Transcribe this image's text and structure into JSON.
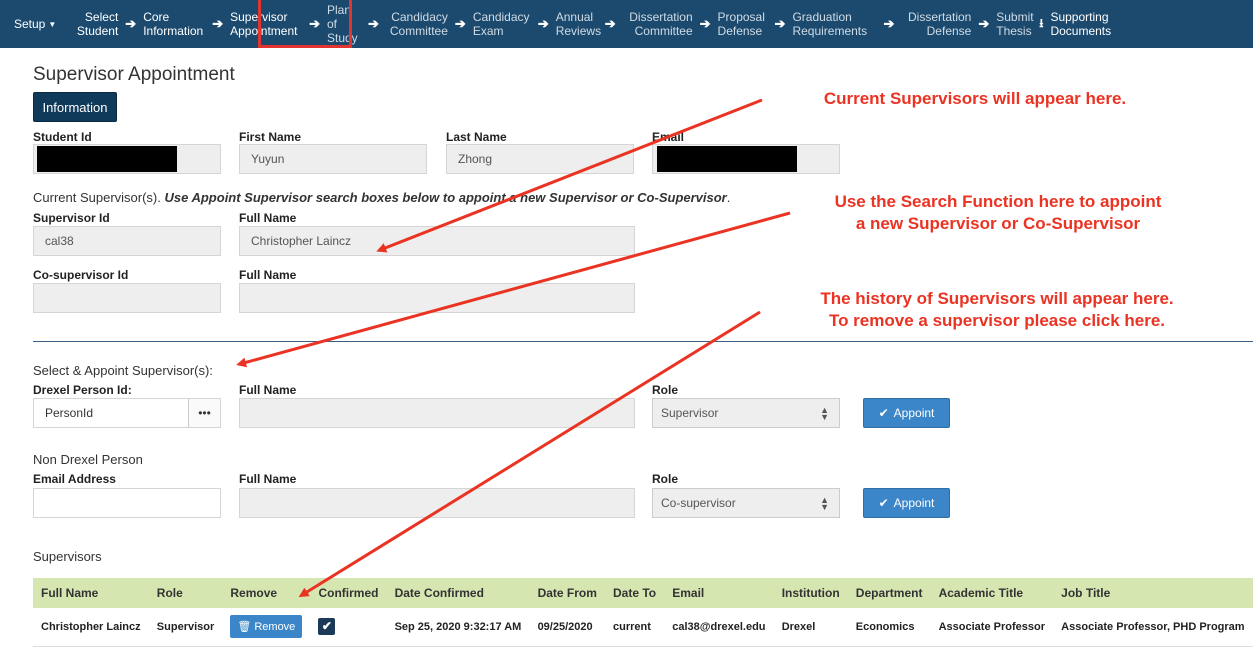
{
  "nav": {
    "setup": "Setup",
    "items": [
      {
        "l1": "Select",
        "l2": "Student"
      },
      {
        "l1": "Core",
        "l2": "Information"
      },
      {
        "l1": "Supervisor",
        "l2": "Appointment"
      },
      {
        "l1": "Plan of",
        "l2": "Study"
      },
      {
        "l1": "Candidacy",
        "l2": "Committee"
      },
      {
        "l1": "Candidacy",
        "l2": "Exam"
      },
      {
        "l1": "Annual",
        "l2": "Reviews"
      },
      {
        "l1": "Dissertation",
        "l2": "Committee"
      },
      {
        "l1": "Proposal",
        "l2": "Defense"
      },
      {
        "l1": "Graduation",
        "l2": "Requirements"
      },
      {
        "l1": "Dissertation",
        "l2": "Defense"
      },
      {
        "l1": "Submit",
        "l2": "Thesis"
      },
      {
        "l1": "Supporting",
        "l2": "Documents"
      }
    ]
  },
  "page_title": "Supervisor Appointment",
  "info_button": "Information",
  "student": {
    "id_label": "Student Id",
    "first_label": "First Name",
    "first_value": "Yuyun",
    "last_label": "Last Name",
    "last_value": "Zhong",
    "email_label": "Email"
  },
  "current": {
    "intro": "Current Supervisor(s).",
    "instruction": "Use Appoint Supervisor search boxes below to appoint a new Supervisor or Co-Supervisor",
    "supervisor_id_label": "Supervisor Id",
    "supervisor_id": "cal38",
    "full_name_label": "Full Name",
    "full_name": "Christopher Laincz",
    "cosup_id_label": "Co-supervisor Id",
    "cosup_full_name_label": "Full Name"
  },
  "appoint": {
    "title": "Select & Appoint Supervisor(s):",
    "person_id_label": "Drexel Person Id:",
    "person_id_value": "PersonId",
    "dots": "•••",
    "full_name_label": "Full Name",
    "role_label": "Role",
    "role_value": "Supervisor",
    "appoint_label": "Appoint"
  },
  "non_drexel": {
    "title": "Non Drexel Person",
    "email_label": "Email Address",
    "full_name_label": "Full Name",
    "role_label": "Role",
    "role_value": "Co-supervisor",
    "appoint_label": "Appoint"
  },
  "supervisors": {
    "title": "Supervisors",
    "headers": [
      "Full Name",
      "Role",
      "Remove",
      "Confirmed",
      "Date Confirmed",
      "Date From",
      "Date To",
      "Email",
      "Institution",
      "Department",
      "Academic Title",
      "Job Title"
    ],
    "row": {
      "full_name": "Christopher Laincz",
      "role": "Supervisor",
      "remove": "Remove",
      "date_confirmed": "Sep 25, 2020 9:32:17 AM",
      "date_from": "09/25/2020",
      "date_to": "current",
      "email": "cal38@drexel.edu",
      "institution": "Drexel",
      "department": "Economics",
      "academic_title": "Associate Professor",
      "job_title": "Associate Professor, PHD Program"
    }
  },
  "annotations": {
    "a1": "Current Supervisors will appear here.",
    "a2_l1": "Use the Search Function here to appoint",
    "a2_l2": "a new Supervisor or Co-Supervisor",
    "a3_l1": "The history of Supervisors will appear here.",
    "a3_l2": "To remove a supervisor please click here."
  },
  "colors": {
    "nav_bg": "#1c4a6e",
    "annotation": "#ea3323",
    "table_header": "#d6e6b1",
    "button_blue": "#3a86c8"
  }
}
